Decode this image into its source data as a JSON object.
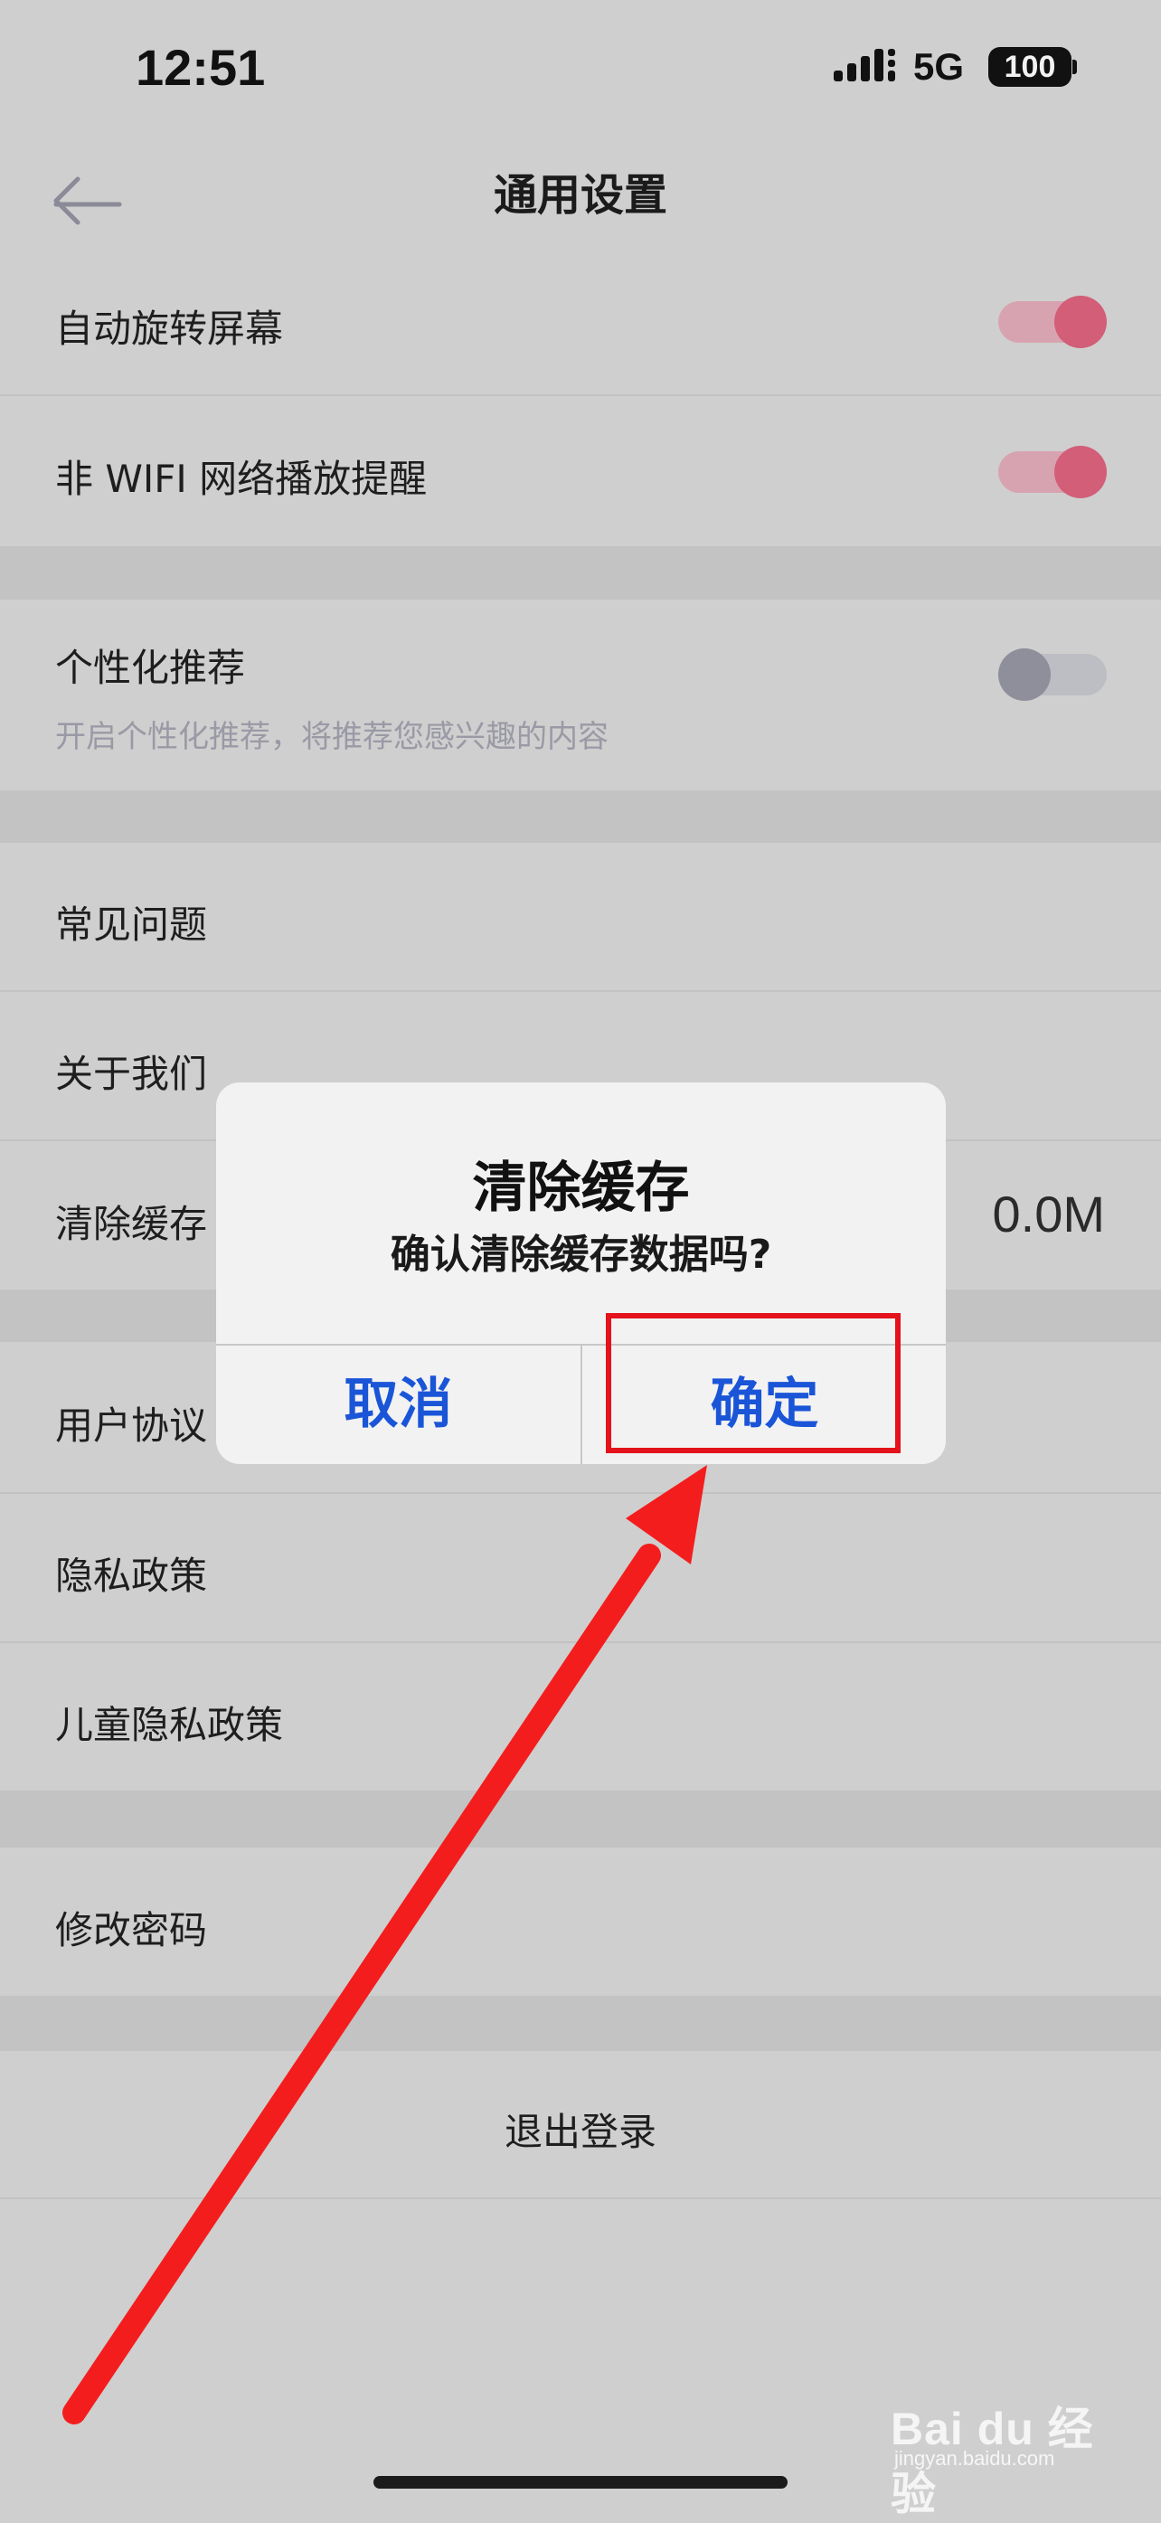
{
  "status_bar": {
    "time": "12:51",
    "network": "5G",
    "battery": "100"
  },
  "nav": {
    "back_icon": "arrow-left-icon",
    "title": "通用设置"
  },
  "settings": {
    "auto_rotate": {
      "label": "自动旋转屏幕",
      "enabled": true
    },
    "non_wifi_alert": {
      "label": "非 WIFI 网络播放提醒",
      "enabled": true
    },
    "personalized": {
      "label": "个性化推荐",
      "description": "开启个性化推荐，将推荐您感兴趣的内容",
      "enabled": false
    },
    "faq": {
      "label": "常见问题"
    },
    "about": {
      "label": "关于我们"
    },
    "clear_cache": {
      "label": "清除缓存",
      "value": "0.0M"
    },
    "user_agreement": {
      "label": "用户协议"
    },
    "privacy_policy": {
      "label": "隐私政策"
    },
    "child_privacy": {
      "label": "儿童隐私政策"
    },
    "change_password": {
      "label": "修改密码"
    },
    "logout": {
      "label": "退出登录"
    }
  },
  "dialog": {
    "title": "清除缓存",
    "message": "确认清除缓存数据吗?",
    "cancel_label": "取消",
    "confirm_label": "确定"
  },
  "watermark": {
    "logo_text": "Bai du 经验",
    "url": "jingyan.baidu.com"
  },
  "colors": {
    "toggle_on": "#d25e78",
    "toggle_off": "#8f8f9c",
    "dialog_button": "#1a55d8",
    "annotation_red": "#e3121b"
  }
}
